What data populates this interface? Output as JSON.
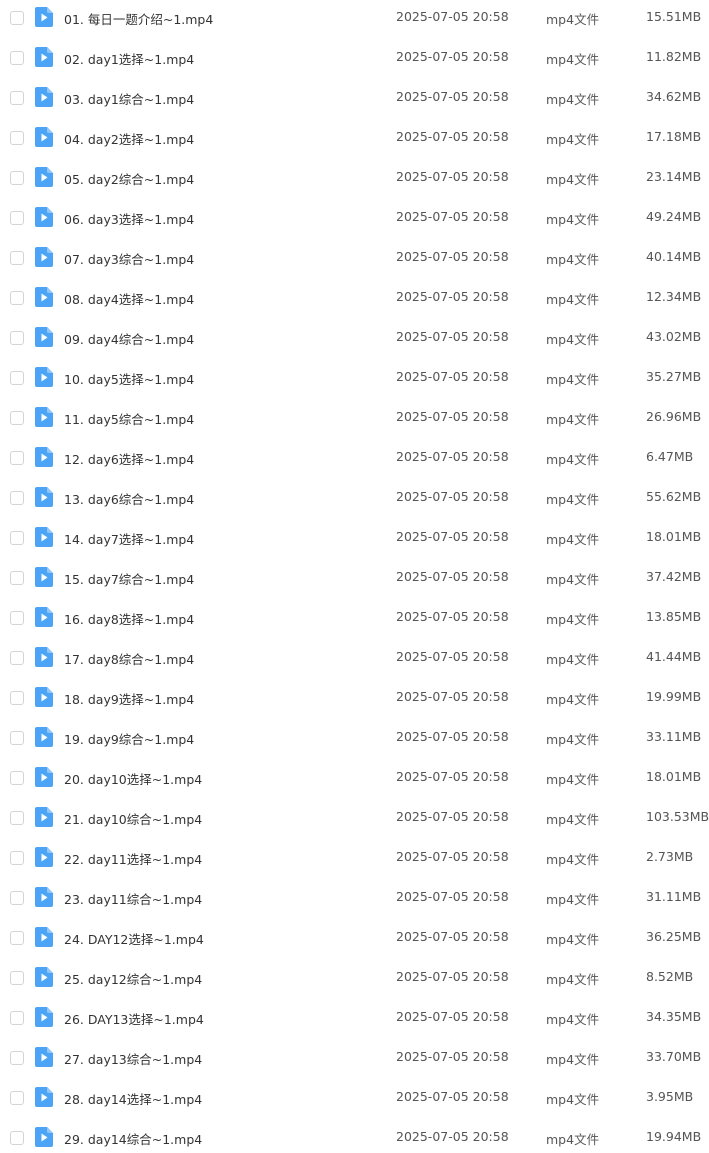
{
  "file_list": {
    "icon": "video-file-icon",
    "accent": "#4DA3F5",
    "rows": [
      {
        "name": "01. 每日一题介绍~1.mp4",
        "time": "2025-07-05 20:58",
        "type": "mp4文件",
        "size": "15.51MB"
      },
      {
        "name": "02. day1选择~1.mp4",
        "time": "2025-07-05 20:58",
        "type": "mp4文件",
        "size": "11.82MB"
      },
      {
        "name": "03. day1综合~1.mp4",
        "time": "2025-07-05 20:58",
        "type": "mp4文件",
        "size": "34.62MB"
      },
      {
        "name": "04. day2选择~1.mp4",
        "time": "2025-07-05 20:58",
        "type": "mp4文件",
        "size": "17.18MB"
      },
      {
        "name": "05. day2综合~1.mp4",
        "time": "2025-07-05 20:58",
        "type": "mp4文件",
        "size": "23.14MB"
      },
      {
        "name": "06. day3选择~1.mp4",
        "time": "2025-07-05 20:58",
        "type": "mp4文件",
        "size": "49.24MB"
      },
      {
        "name": "07. day3综合~1.mp4",
        "time": "2025-07-05 20:58",
        "type": "mp4文件",
        "size": "40.14MB"
      },
      {
        "name": "08. day4选择~1.mp4",
        "time": "2025-07-05 20:58",
        "type": "mp4文件",
        "size": "12.34MB"
      },
      {
        "name": "09. day4综合~1.mp4",
        "time": "2025-07-05 20:58",
        "type": "mp4文件",
        "size": "43.02MB"
      },
      {
        "name": "10. day5选择~1.mp4",
        "time": "2025-07-05 20:58",
        "type": "mp4文件",
        "size": "35.27MB"
      },
      {
        "name": "11. day5综合~1.mp4",
        "time": "2025-07-05 20:58",
        "type": "mp4文件",
        "size": "26.96MB"
      },
      {
        "name": "12. day6选择~1.mp4",
        "time": "2025-07-05 20:58",
        "type": "mp4文件",
        "size": "6.47MB"
      },
      {
        "name": "13. day6综合~1.mp4",
        "time": "2025-07-05 20:58",
        "type": "mp4文件",
        "size": "55.62MB"
      },
      {
        "name": "14. day7选择~1.mp4",
        "time": "2025-07-05 20:58",
        "type": "mp4文件",
        "size": "18.01MB"
      },
      {
        "name": "15. day7综合~1.mp4",
        "time": "2025-07-05 20:58",
        "type": "mp4文件",
        "size": "37.42MB"
      },
      {
        "name": "16. day8选择~1.mp4",
        "time": "2025-07-05 20:58",
        "type": "mp4文件",
        "size": "13.85MB"
      },
      {
        "name": "17. day8综合~1.mp4",
        "time": "2025-07-05 20:58",
        "type": "mp4文件",
        "size": "41.44MB"
      },
      {
        "name": "18. day9选择~1.mp4",
        "time": "2025-07-05 20:58",
        "type": "mp4文件",
        "size": "19.99MB"
      },
      {
        "name": "19. day9综合~1.mp4",
        "time": "2025-07-05 20:58",
        "type": "mp4文件",
        "size": "33.11MB"
      },
      {
        "name": "20. day10选择~1.mp4",
        "time": "2025-07-05 20:58",
        "type": "mp4文件",
        "size": "18.01MB"
      },
      {
        "name": "21. day10综合~1.mp4",
        "time": "2025-07-05 20:58",
        "type": "mp4文件",
        "size": "103.53MB"
      },
      {
        "name": "22. day11选择~1.mp4",
        "time": "2025-07-05 20:58",
        "type": "mp4文件",
        "size": "2.73MB"
      },
      {
        "name": "23. day11综合~1.mp4",
        "time": "2025-07-05 20:58",
        "type": "mp4文件",
        "size": "31.11MB"
      },
      {
        "name": "24. DAY12选择~1.mp4",
        "time": "2025-07-05 20:58",
        "type": "mp4文件",
        "size": "36.25MB"
      },
      {
        "name": "25. day12综合~1.mp4",
        "time": "2025-07-05 20:58",
        "type": "mp4文件",
        "size": "8.52MB"
      },
      {
        "name": "26. DAY13选择~1.mp4",
        "time": "2025-07-05 20:58",
        "type": "mp4文件",
        "size": "34.35MB"
      },
      {
        "name": "27. day13综合~1.mp4",
        "time": "2025-07-05 20:58",
        "type": "mp4文件",
        "size": "33.70MB"
      },
      {
        "name": "28. day14选择~1.mp4",
        "time": "2025-07-05 20:58",
        "type": "mp4文件",
        "size": "3.95MB"
      },
      {
        "name": "29. day14综合~1.mp4",
        "time": "2025-07-05 20:58",
        "type": "mp4文件",
        "size": "19.94MB"
      }
    ]
  }
}
